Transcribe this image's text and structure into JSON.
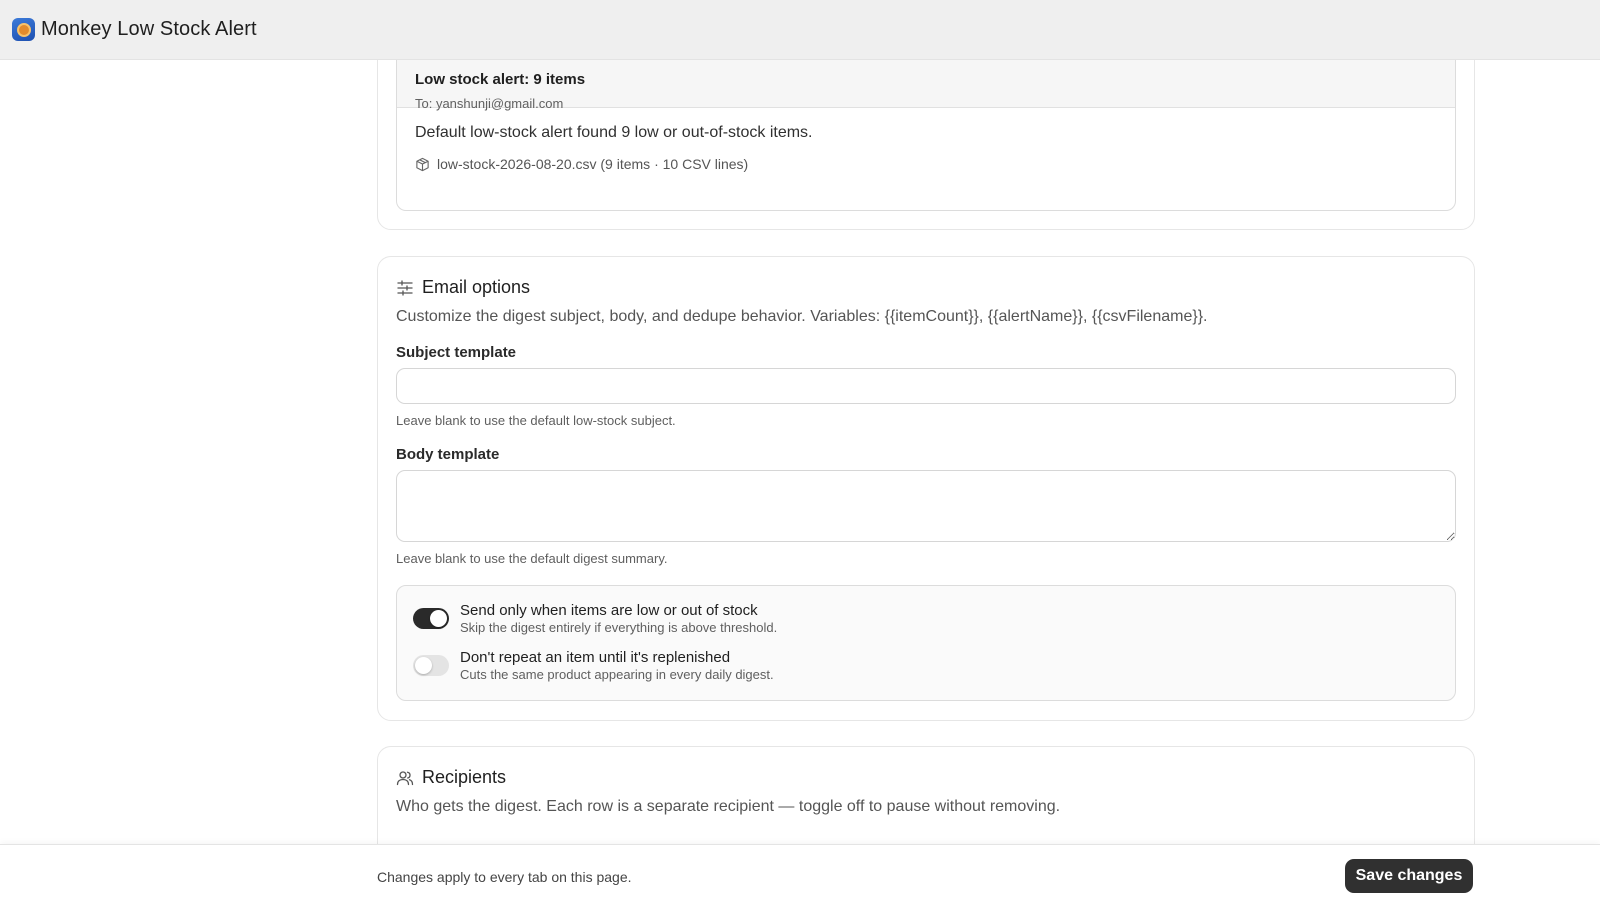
{
  "app": {
    "title": "Monkey Low Stock Alert"
  },
  "preview": {
    "subject": "Low stock alert: 9 items",
    "to": "To: yanshunji@gmail.com",
    "body": "Default low-stock alert found 9 low or out-of-stock items.",
    "attachment": "low-stock-2026-08-20.csv (9 items · 10 CSV lines)"
  },
  "email_options": {
    "title": "Email options",
    "description": "Customize the digest subject, body, and dedupe behavior. Variables: {{itemCount}}, {{alertName}}, {{csvFilename}}.",
    "subject_label": "Subject template",
    "subject_value": "",
    "subject_help": "Leave blank to use the default low-stock subject.",
    "body_label": "Body template",
    "body_value": "",
    "body_help": "Leave blank to use the default digest summary.",
    "toggles": [
      {
        "title": "Send only when items are low or out of stock",
        "subtitle": "Skip the digest entirely if everything is above threshold.",
        "state": "on"
      },
      {
        "title": "Don't repeat an item until it's replenished",
        "subtitle": "Cuts the same product appearing in every daily digest.",
        "state": "off"
      }
    ]
  },
  "recipients": {
    "title": "Recipients",
    "description": "Who gets the digest. Each row is a separate recipient — toggle off to pause without removing."
  },
  "footer": {
    "note": "Changes apply to every tab on this page.",
    "save_label": "Save changes"
  },
  "colors": {
    "accent": "#303030",
    "toggle_on": "#2a2a2a",
    "toggle_off": "#e4e4e4"
  },
  "icons": {
    "app": "monkey-app-icon",
    "attachment": "package-icon",
    "options": "sliders-icon",
    "recipients": "users-icon"
  }
}
